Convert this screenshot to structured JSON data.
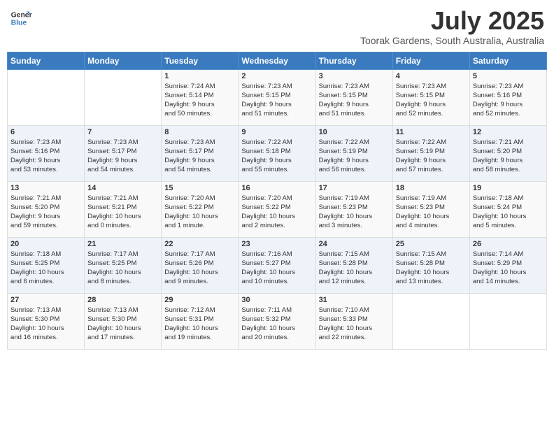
{
  "logo": {
    "line1": "General",
    "line2": "Blue"
  },
  "title": "July 2025",
  "subtitle": "Toorak Gardens, South Australia, Australia",
  "weekdays": [
    "Sunday",
    "Monday",
    "Tuesday",
    "Wednesday",
    "Thursday",
    "Friday",
    "Saturday"
  ],
  "weeks": [
    [
      {
        "day": "",
        "info": ""
      },
      {
        "day": "",
        "info": ""
      },
      {
        "day": "1",
        "info": "Sunrise: 7:24 AM\nSunset: 5:14 PM\nDaylight: 9 hours\nand 50 minutes."
      },
      {
        "day": "2",
        "info": "Sunrise: 7:23 AM\nSunset: 5:15 PM\nDaylight: 9 hours\nand 51 minutes."
      },
      {
        "day": "3",
        "info": "Sunrise: 7:23 AM\nSunset: 5:15 PM\nDaylight: 9 hours\nand 51 minutes."
      },
      {
        "day": "4",
        "info": "Sunrise: 7:23 AM\nSunset: 5:15 PM\nDaylight: 9 hours\nand 52 minutes."
      },
      {
        "day": "5",
        "info": "Sunrise: 7:23 AM\nSunset: 5:16 PM\nDaylight: 9 hours\nand 52 minutes."
      }
    ],
    [
      {
        "day": "6",
        "info": "Sunrise: 7:23 AM\nSunset: 5:16 PM\nDaylight: 9 hours\nand 53 minutes."
      },
      {
        "day": "7",
        "info": "Sunrise: 7:23 AM\nSunset: 5:17 PM\nDaylight: 9 hours\nand 54 minutes."
      },
      {
        "day": "8",
        "info": "Sunrise: 7:23 AM\nSunset: 5:17 PM\nDaylight: 9 hours\nand 54 minutes."
      },
      {
        "day": "9",
        "info": "Sunrise: 7:22 AM\nSunset: 5:18 PM\nDaylight: 9 hours\nand 55 minutes."
      },
      {
        "day": "10",
        "info": "Sunrise: 7:22 AM\nSunset: 5:19 PM\nDaylight: 9 hours\nand 56 minutes."
      },
      {
        "day": "11",
        "info": "Sunrise: 7:22 AM\nSunset: 5:19 PM\nDaylight: 9 hours\nand 57 minutes."
      },
      {
        "day": "12",
        "info": "Sunrise: 7:21 AM\nSunset: 5:20 PM\nDaylight: 9 hours\nand 58 minutes."
      }
    ],
    [
      {
        "day": "13",
        "info": "Sunrise: 7:21 AM\nSunset: 5:20 PM\nDaylight: 9 hours\nand 59 minutes."
      },
      {
        "day": "14",
        "info": "Sunrise: 7:21 AM\nSunset: 5:21 PM\nDaylight: 10 hours\nand 0 minutes."
      },
      {
        "day": "15",
        "info": "Sunrise: 7:20 AM\nSunset: 5:22 PM\nDaylight: 10 hours\nand 1 minute."
      },
      {
        "day": "16",
        "info": "Sunrise: 7:20 AM\nSunset: 5:22 PM\nDaylight: 10 hours\nand 2 minutes."
      },
      {
        "day": "17",
        "info": "Sunrise: 7:19 AM\nSunset: 5:23 PM\nDaylight: 10 hours\nand 3 minutes."
      },
      {
        "day": "18",
        "info": "Sunrise: 7:19 AM\nSunset: 5:23 PM\nDaylight: 10 hours\nand 4 minutes."
      },
      {
        "day": "19",
        "info": "Sunrise: 7:18 AM\nSunset: 5:24 PM\nDaylight: 10 hours\nand 5 minutes."
      }
    ],
    [
      {
        "day": "20",
        "info": "Sunrise: 7:18 AM\nSunset: 5:25 PM\nDaylight: 10 hours\nand 6 minutes."
      },
      {
        "day": "21",
        "info": "Sunrise: 7:17 AM\nSunset: 5:25 PM\nDaylight: 10 hours\nand 8 minutes."
      },
      {
        "day": "22",
        "info": "Sunrise: 7:17 AM\nSunset: 5:26 PM\nDaylight: 10 hours\nand 9 minutes."
      },
      {
        "day": "23",
        "info": "Sunrise: 7:16 AM\nSunset: 5:27 PM\nDaylight: 10 hours\nand 10 minutes."
      },
      {
        "day": "24",
        "info": "Sunrise: 7:15 AM\nSunset: 5:28 PM\nDaylight: 10 hours\nand 12 minutes."
      },
      {
        "day": "25",
        "info": "Sunrise: 7:15 AM\nSunset: 5:28 PM\nDaylight: 10 hours\nand 13 minutes."
      },
      {
        "day": "26",
        "info": "Sunrise: 7:14 AM\nSunset: 5:29 PM\nDaylight: 10 hours\nand 14 minutes."
      }
    ],
    [
      {
        "day": "27",
        "info": "Sunrise: 7:13 AM\nSunset: 5:30 PM\nDaylight: 10 hours\nand 16 minutes."
      },
      {
        "day": "28",
        "info": "Sunrise: 7:13 AM\nSunset: 5:30 PM\nDaylight: 10 hours\nand 17 minutes."
      },
      {
        "day": "29",
        "info": "Sunrise: 7:12 AM\nSunset: 5:31 PM\nDaylight: 10 hours\nand 19 minutes."
      },
      {
        "day": "30",
        "info": "Sunrise: 7:11 AM\nSunset: 5:32 PM\nDaylight: 10 hours\nand 20 minutes."
      },
      {
        "day": "31",
        "info": "Sunrise: 7:10 AM\nSunset: 5:33 PM\nDaylight: 10 hours\nand 22 minutes."
      },
      {
        "day": "",
        "info": ""
      },
      {
        "day": "",
        "info": ""
      }
    ]
  ]
}
